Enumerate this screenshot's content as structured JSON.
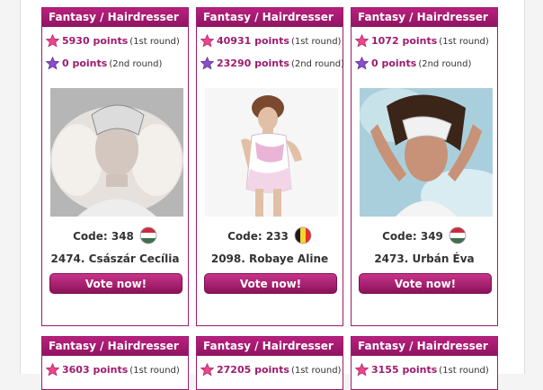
{
  "cards": [
    {
      "category": "Fantasy / Hairdresser",
      "round1": {
        "points": "5930 points",
        "label": "(1st round)"
      },
      "round2": {
        "points": "0 points",
        "label": "(2nd round)"
      },
      "photo_alt": "Model with white crystal headpiece",
      "code_label": "Code: 348",
      "flag": "hungary-flag-icon",
      "name": "2474. Császár Cecília",
      "vote_label": "Vote now!"
    },
    {
      "category": "Fantasy / Hairdresser",
      "round1": {
        "points": "40931 points",
        "label": "(1st round)"
      },
      "round2": {
        "points": "23290 points",
        "label": "(2nd round)"
      },
      "photo_alt": "Model in white dress with pink accents",
      "code_label": "Code: 233",
      "flag": "belgium-flag-icon",
      "name": "2098. Robaye Aline",
      "vote_label": "Vote now!"
    },
    {
      "category": "Fantasy / Hairdresser",
      "round1": {
        "points": "1072 points",
        "label": "(1st round)"
      },
      "round2": {
        "points": "0 points",
        "label": "(2nd round)"
      },
      "photo_alt": "Model with dark hair and white ornaments",
      "code_label": "Code: 349",
      "flag": "hungary-flag-icon",
      "name": "2473. Urbán Éva",
      "vote_label": "Vote now!"
    },
    {
      "category": "Fantasy / Hairdresser",
      "round1": {
        "points": "3603 points",
        "label": "(1st round)"
      }
    },
    {
      "category": "Fantasy / Hairdresser",
      "round1": {
        "points": "27205 points",
        "label": "(1st round)"
      }
    },
    {
      "category": "Fantasy / Hairdresser",
      "round1": {
        "points": "3155 points",
        "label": "(1st round)"
      }
    }
  ],
  "colors": {
    "brand": "#9c1c6e",
    "star_round1": "#e8468f",
    "star_round2": "#8a4fc7"
  }
}
